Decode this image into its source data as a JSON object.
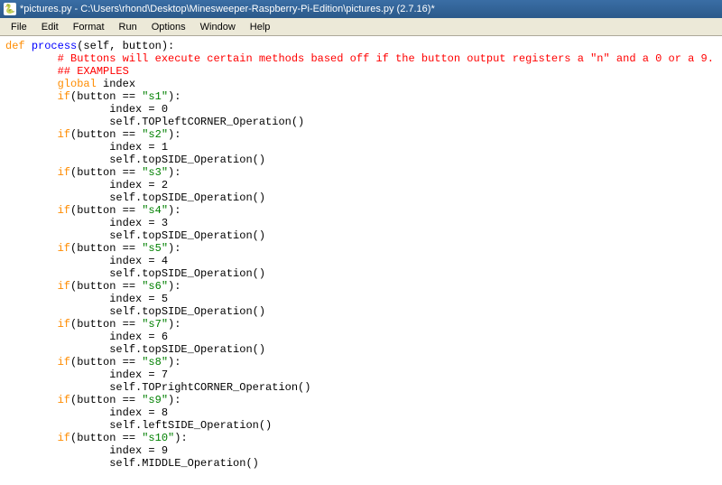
{
  "titlebar": {
    "text": "*pictures.py - C:\\Users\\rhond\\Desktop\\Minesweeper-Raspberry-Pi-Edition\\pictures.py (2.7.16)*"
  },
  "menubar": {
    "items": [
      "File",
      "Edit",
      "Format",
      "Run",
      "Options",
      "Window",
      "Help"
    ]
  },
  "code": {
    "def": "def",
    "funcname": "process",
    "params": "(self, button):",
    "comment1": "# Buttons will execute certain methods based off if the button output registers a \"n\" and a 0 or a 9.",
    "comment2": "## EXAMPLES",
    "global": "global",
    "indexword": "index",
    "if": "if",
    "branches": [
      {
        "sid": "\"s1\"",
        "idx": "0",
        "op": "self.TOPleftCORNER_Operation()"
      },
      {
        "sid": "\"s2\"",
        "idx": "1",
        "op": "self.topSIDE_Operation()"
      },
      {
        "sid": "\"s3\"",
        "idx": "2",
        "op": "self.topSIDE_Operation()"
      },
      {
        "sid": "\"s4\"",
        "idx": "3",
        "op": "self.topSIDE_Operation()"
      },
      {
        "sid": "\"s5\"",
        "idx": "4",
        "op": "self.topSIDE_Operation()"
      },
      {
        "sid": "\"s6\"",
        "idx": "5",
        "op": "self.topSIDE_Operation()"
      },
      {
        "sid": "\"s7\"",
        "idx": "6",
        "op": "self.topSIDE_Operation()"
      },
      {
        "sid": "\"s8\"",
        "idx": "7",
        "op": "self.TOPrightCORNER_Operation()"
      },
      {
        "sid": "\"s9\"",
        "idx": "8",
        "op": "self.leftSIDE_Operation()"
      },
      {
        "sid": "\"s10\"",
        "idx": "9",
        "op": "self.MIDDLE_Operation()"
      }
    ]
  }
}
